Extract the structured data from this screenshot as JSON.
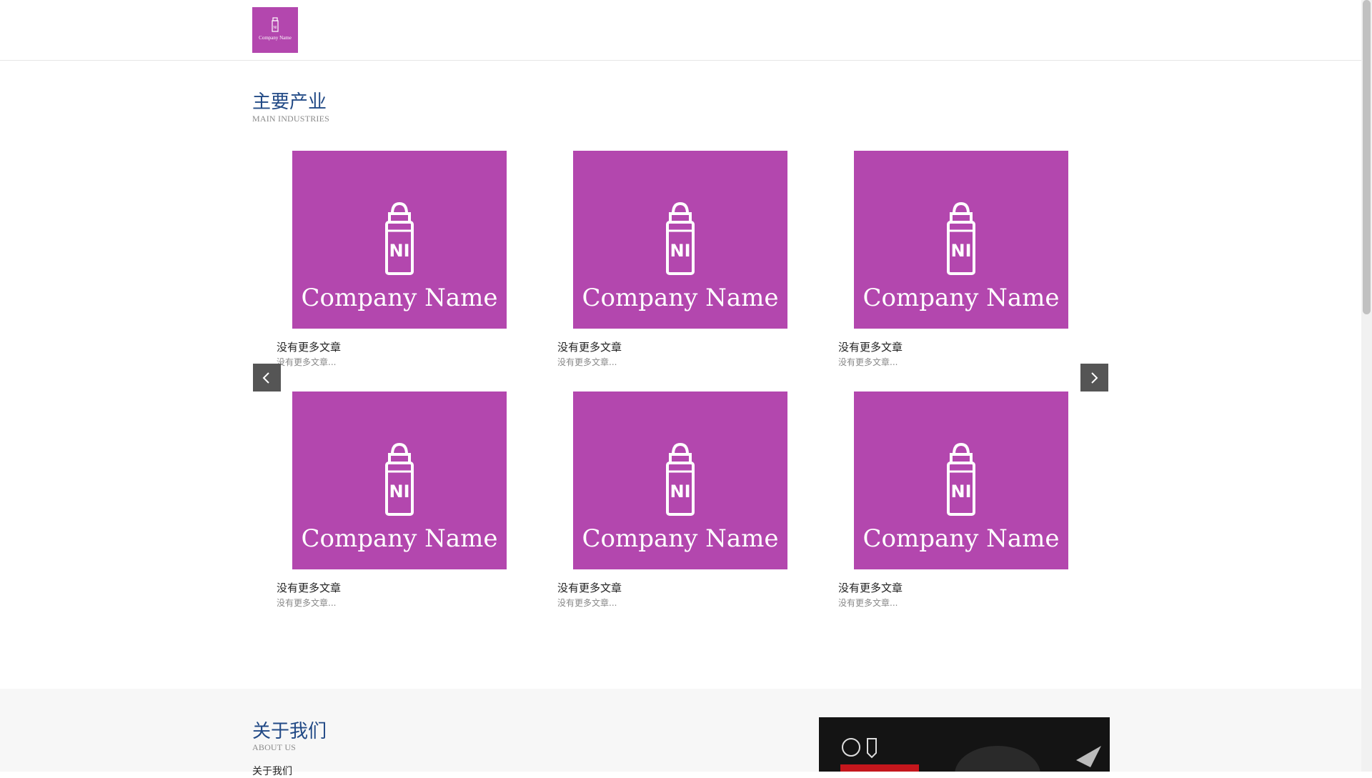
{
  "header": {
    "logo_text": "Company Name"
  },
  "industries": {
    "title": "主要产业",
    "subtitle": "MAIN INDUSTRIES",
    "prev_label": "previous",
    "next_label": "next",
    "cards": [
      {
        "image_text": "Company Name",
        "title": "没有更多文章",
        "desc": "没有更多文章..."
      },
      {
        "image_text": "Company Name",
        "title": "没有更多文章",
        "desc": "没有更多文章..."
      },
      {
        "image_text": "Company Name",
        "title": "没有更多文章",
        "desc": "没有更多文章..."
      },
      {
        "image_text": "Company Name",
        "title": "没有更多文章",
        "desc": "没有更多文章..."
      },
      {
        "image_text": "Company Name",
        "title": "没有更多文章",
        "desc": "没有更多文章..."
      },
      {
        "image_text": "Company Name",
        "title": "没有更多文章",
        "desc": "没有更多文章..."
      }
    ]
  },
  "about": {
    "title": "关于我们",
    "subtitle": "ABOUT US",
    "partial_text": "关于我们"
  },
  "colors": {
    "brand": "#b347ae",
    "heading": "#224a86",
    "arrow_bg": "#555555"
  }
}
